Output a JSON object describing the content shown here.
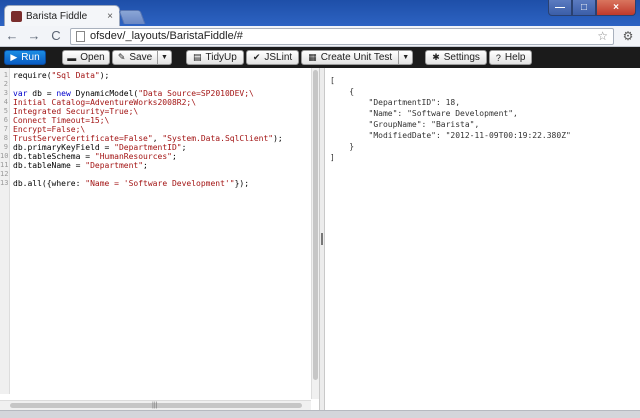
{
  "browser": {
    "tab_title": "Barista Fiddle",
    "tab_close": "×",
    "url": "ofsdev/_layouts/BaristaFiddle/#",
    "back_glyph": "←",
    "forward_glyph": "→",
    "reload_glyph": "C",
    "star_glyph": "☆",
    "wrench_glyph": "⚙",
    "min_glyph": "—",
    "max_glyph": "□",
    "close_glyph": "×"
  },
  "toolbar": {
    "run_label": "Run",
    "open_label": "Open",
    "save_label": "Save",
    "tidyup_label": "TidyUp",
    "jslint_label": "JSLint",
    "create_unit_test_label": "Create Unit Test",
    "settings_label": "Settings",
    "help_label": "Help",
    "caret_glyph": "▼"
  },
  "editor": {
    "lines": [
      {
        "n": "1",
        "parts": [
          [
            "",
            "require("
          ],
          [
            "str",
            "\"Sql Data\""
          ],
          [
            "",
            ");"
          ]
        ]
      },
      {
        "n": "2",
        "parts": [
          [
            "",
            ""
          ]
        ]
      },
      {
        "n": "3",
        "parts": [
          [
            "kw",
            "var"
          ],
          [
            "",
            " db = "
          ],
          [
            "kw",
            "new"
          ],
          [
            "",
            " DynamicModel("
          ],
          [
            "str",
            "\"Data Source=SP2010DEV;\\"
          ]
        ]
      },
      {
        "n": "4",
        "parts": [
          [
            "str",
            "Initial Catalog=AdventureWorks2008R2;\\"
          ]
        ]
      },
      {
        "n": "5",
        "parts": [
          [
            "str",
            "Integrated Security=True;\\"
          ]
        ]
      },
      {
        "n": "6",
        "parts": [
          [
            "str",
            "Connect Timeout=15;\\"
          ]
        ]
      },
      {
        "n": "7",
        "parts": [
          [
            "str",
            "Encrypt=False;\\"
          ]
        ]
      },
      {
        "n": "8",
        "parts": [
          [
            "str",
            "TrustServerCertificate=False\""
          ],
          [
            "",
            ", "
          ],
          [
            "str",
            "\"System.Data.SqlClient\""
          ],
          [
            "",
            ");"
          ]
        ]
      },
      {
        "n": "9",
        "parts": [
          [
            "",
            "db.primaryKeyField = "
          ],
          [
            "str",
            "\"DepartmentID\""
          ],
          [
            "",
            ";"
          ]
        ]
      },
      {
        "n": "10",
        "parts": [
          [
            "",
            "db.tableSchema = "
          ],
          [
            "str",
            "\"HumanResources\""
          ],
          [
            "",
            ";"
          ]
        ]
      },
      {
        "n": "11",
        "parts": [
          [
            "",
            "db.tableName = "
          ],
          [
            "str",
            "\"Department\""
          ],
          [
            "",
            ";"
          ]
        ]
      },
      {
        "n": "12",
        "parts": [
          [
            "",
            ""
          ]
        ]
      },
      {
        "n": "13",
        "parts": [
          [
            "",
            "db.all({where: "
          ],
          [
            "str",
            "\"Name = 'Software Development'\""
          ],
          [
            "",
            "});"
          ]
        ]
      }
    ],
    "hscroll_grip": "|||"
  },
  "output": {
    "lines": [
      "[",
      "    {",
      "        \"DepartmentID\": 18,",
      "        \"Name\": \"Software Development\",",
      "        \"GroupName\": \"Barista\",",
      "        \"ModifiedDate\": \"2012-11-09T00:19:22.380Z\"",
      "    }",
      "]"
    ]
  }
}
